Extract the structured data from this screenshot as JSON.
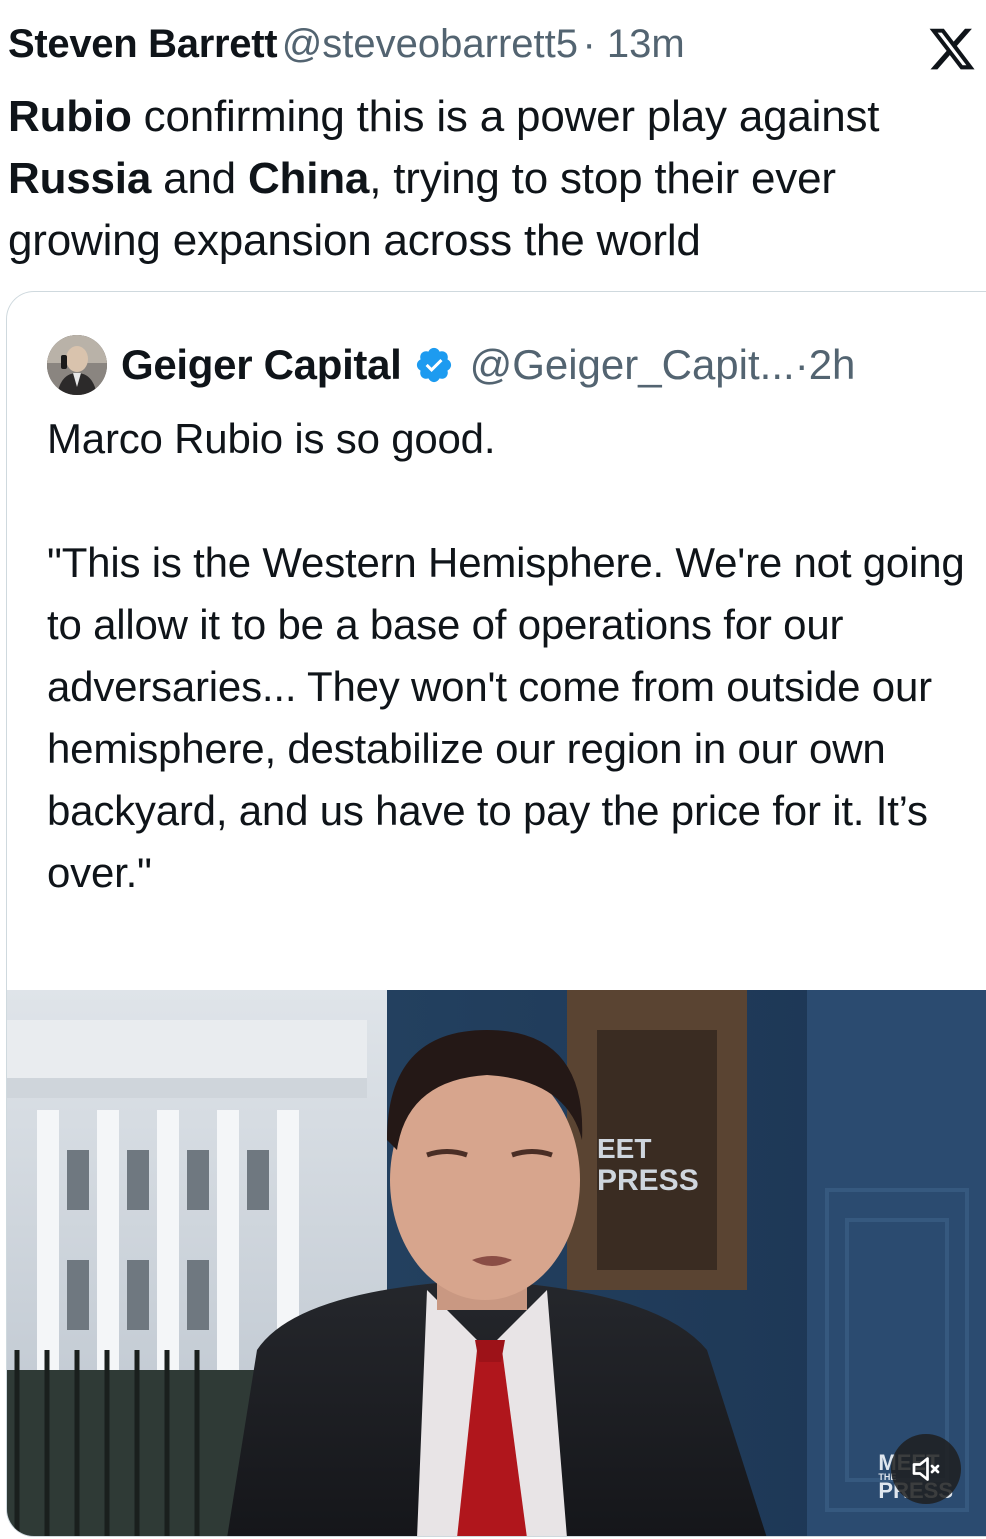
{
  "tweet": {
    "author_name": "Steven Barrett",
    "handle": "@steveobarrett5",
    "separator": "·",
    "time": "13m",
    "text_segments": [
      {
        "bold": true,
        "text": "Rubio"
      },
      {
        "bold": false,
        "text": " confirming this is a power play against "
      },
      {
        "bold": true,
        "text": "Russia"
      },
      {
        "bold": false,
        "text": " and "
      },
      {
        "bold": true,
        "text": "China"
      },
      {
        "bold": false,
        "text": ", trying to stop their ever growing expansion across the world"
      }
    ]
  },
  "quoted": {
    "author_name": "Geiger Capital",
    "handle": "@Geiger_Capit...",
    "separator": "·",
    "time": "2h",
    "line1": "Marco Rubio is so good.",
    "quote_text": "\"This is the Western Hemisphere. We're not going to allow it to be a base of operations for our adversaries... They won't come from outside our hemisphere, destabilize our region in our own backyard, and us have to pay the price for it. It’s over.\""
  },
  "video": {
    "watermark_small_line1": "MEET",
    "watermark_small_line2": "THE",
    "watermark_small_line3": "PRESS",
    "background_sign_line1": "EET",
    "background_sign_line2": "PRESS",
    "mute_icon": "speaker-muted-icon"
  },
  "colors": {
    "text": "#0f1419",
    "meta": "#536471",
    "verified": "#1d9bf0",
    "border": "#cfd9de"
  }
}
